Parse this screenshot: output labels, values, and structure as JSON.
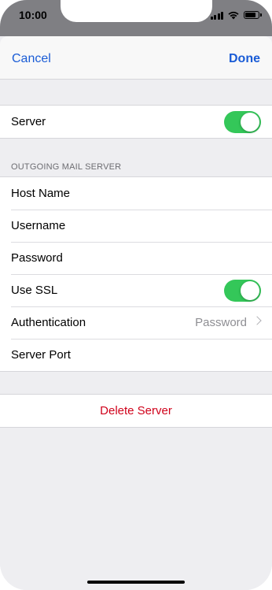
{
  "status_bar": {
    "time": "10:00"
  },
  "nav": {
    "cancel_label": "Cancel",
    "done_label": "Done"
  },
  "server_group": {
    "label": "Server",
    "toggle_on": true
  },
  "outgoing_section": {
    "header": "OUTGOING MAIL SERVER",
    "rows": [
      {
        "label": "Host Name"
      },
      {
        "label": "Username"
      },
      {
        "label": "Password"
      },
      {
        "label": "Use SSL",
        "toggle_on": true
      },
      {
        "label": "Authentication",
        "value": "Password"
      },
      {
        "label": "Server Port"
      }
    ]
  },
  "delete_button": {
    "label": "Delete Server"
  },
  "colors": {
    "accent": "#1a5cd6",
    "toggle_on": "#34c759",
    "destructive": "#d0021b",
    "background": "#eeeef1"
  }
}
